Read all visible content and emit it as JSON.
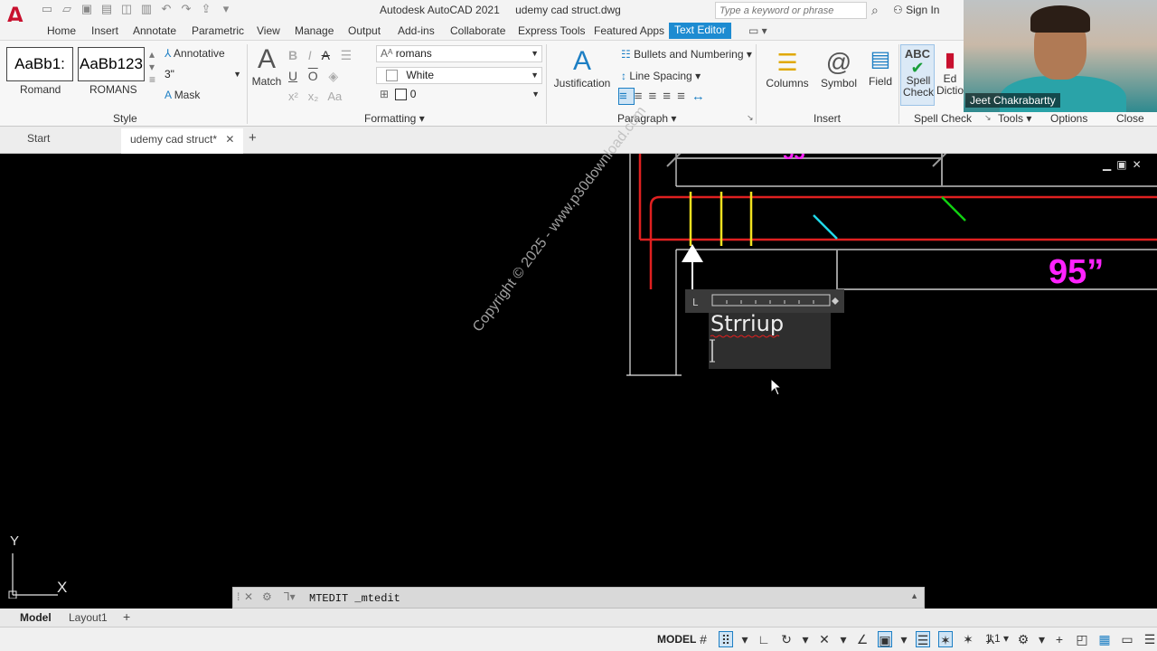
{
  "titlebar": {
    "app_name": "Autodesk AutoCAD 2021",
    "file_name": "udemy cad struct.dwg",
    "search_placeholder": "Type a keyword or phrase",
    "sign_in": "Sign In"
  },
  "ribbon_tabs": [
    "Home",
    "Insert",
    "Annotate",
    "Parametric",
    "View",
    "Manage",
    "Output",
    "Add-ins",
    "Collaborate",
    "Express Tools",
    "Featured Apps",
    "Text Editor"
  ],
  "ribbon": {
    "style": {
      "swatch1_text": "AaBb1:",
      "swatch1_label": "Romand",
      "swatch2_text": "AaBb123",
      "swatch2_label": "ROMANS",
      "annotative": "Annotative",
      "height_value": "3\"",
      "mask": "Mask",
      "panel_label": "Style"
    },
    "formatting": {
      "match": "Match",
      "font": "romans",
      "color": "White",
      "oblique": "0",
      "panel_label": "Formatting"
    },
    "paragraph": {
      "justification": "Justification",
      "bullets": "Bullets and Numbering",
      "line_spacing": "Line Spacing",
      "panel_label": "Paragraph"
    },
    "insert": {
      "columns": "Columns",
      "symbol": "Symbol",
      "field": "Field",
      "panel_label": "Insert"
    },
    "spell": {
      "abc": "ABC",
      "spell_check": "Spell Check",
      "dictionaries": "Ed Dictio",
      "panel_label": "Spell Check"
    },
    "tools_label": "Tools",
    "options_label": "Options",
    "close_label": "Close"
  },
  "webcam": {
    "name": "Jeet Chakrabartty"
  },
  "doc_tabs": {
    "start": "Start",
    "active": "udemy cad struct*"
  },
  "drawing": {
    "mtext": "Strriup",
    "dimension": "95”",
    "watermark": "Copyright © 2025 - www.p30download.com"
  },
  "ucs": {
    "x": "X",
    "y": "Y"
  },
  "command_line": {
    "text": "MTEDIT _mtedit"
  },
  "layout_tabs": [
    "Model",
    "Layout1"
  ],
  "status_bar": {
    "model": "MODEL",
    "scale": "1:1"
  }
}
